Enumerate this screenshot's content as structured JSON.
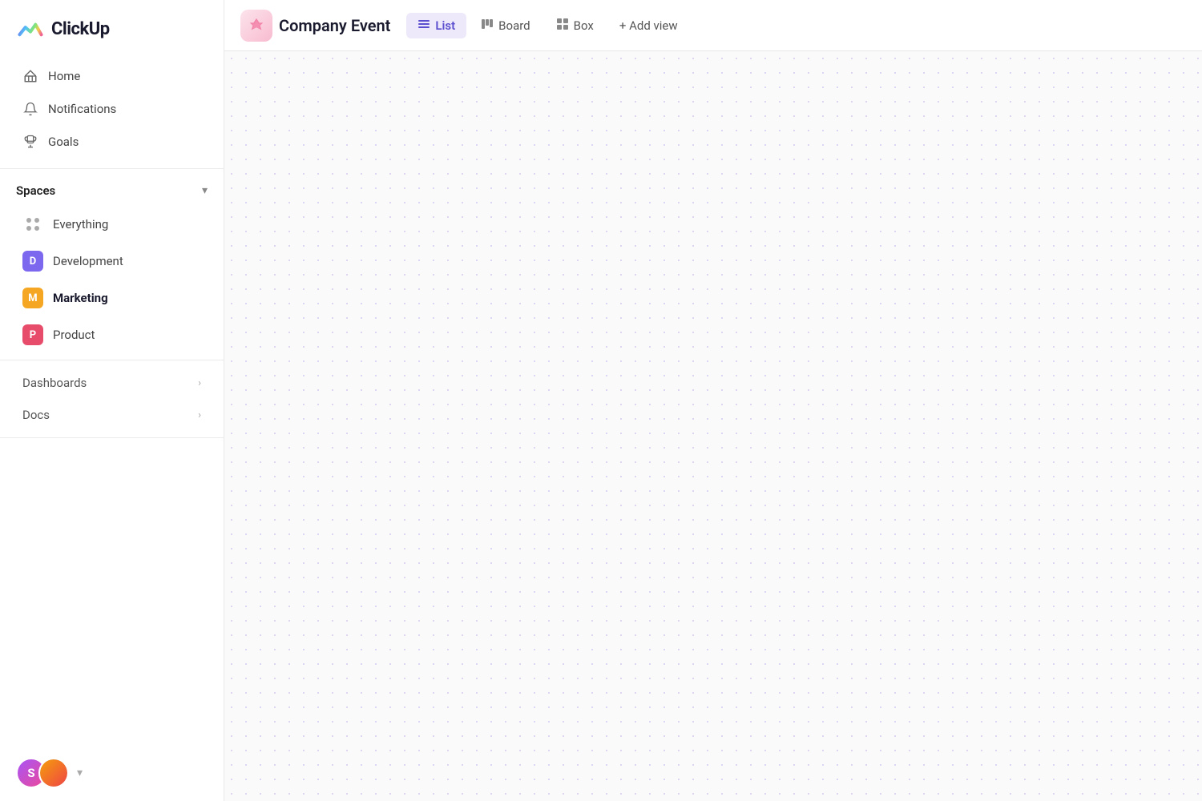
{
  "logo": {
    "text": "ClickUp"
  },
  "sidebar": {
    "nav": [
      {
        "id": "home",
        "label": "Home",
        "icon": "home"
      },
      {
        "id": "notifications",
        "label": "Notifications",
        "icon": "bell"
      },
      {
        "id": "goals",
        "label": "Goals",
        "icon": "trophy"
      }
    ],
    "spaces_label": "Spaces",
    "spaces": [
      {
        "id": "everything",
        "label": "Everything",
        "type": "dots"
      },
      {
        "id": "development",
        "label": "Development",
        "type": "avatar",
        "letter": "D",
        "class": "dev"
      },
      {
        "id": "marketing",
        "label": "Marketing",
        "type": "avatar",
        "letter": "M",
        "class": "mkt",
        "bold": true
      },
      {
        "id": "product",
        "label": "Product",
        "type": "avatar",
        "letter": "P",
        "class": "prd"
      }
    ],
    "sections": [
      {
        "id": "dashboards",
        "label": "Dashboards"
      },
      {
        "id": "docs",
        "label": "Docs"
      }
    ]
  },
  "topbar": {
    "project_name": "Company Event",
    "views": [
      {
        "id": "list",
        "label": "List",
        "icon": "≡",
        "active": true
      },
      {
        "id": "board",
        "label": "Board",
        "icon": "▦",
        "active": false
      },
      {
        "id": "box",
        "label": "Box",
        "icon": "⊞",
        "active": false
      }
    ],
    "add_view_label": "+ Add view"
  }
}
